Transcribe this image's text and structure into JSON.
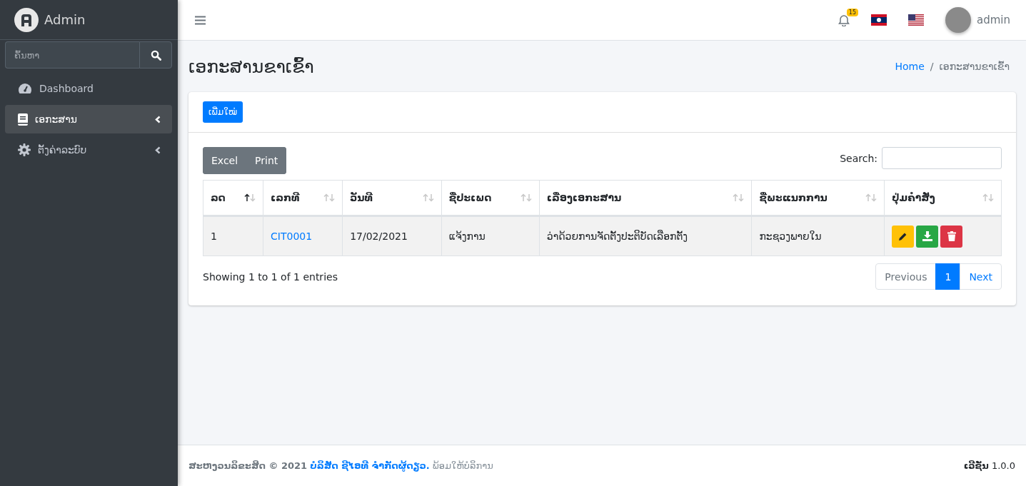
{
  "brand": {
    "name": "Admin"
  },
  "sidebar": {
    "search": {
      "placeholder": "ຄົ້ນຫາ"
    },
    "items": [
      {
        "label": "Dashboard",
        "kind": "dashboard",
        "selected": false,
        "expandable": false
      },
      {
        "label": "ເອກະສານ",
        "kind": "book",
        "selected": true,
        "expandable": true
      },
      {
        "label": "ຕັ້ງຄ່າລະບົບ",
        "kind": "gear",
        "selected": false,
        "expandable": true
      }
    ]
  },
  "topbar": {
    "notification_count": "15",
    "user": "admin"
  },
  "page": {
    "title": "ເອກະສານຂາເຂົ້າ",
    "breadcrumb_separator": "/",
    "breadcrumb": [
      {
        "label": "Home",
        "link": true
      },
      {
        "label": "ເອກະສານຂາເຂົ້າ",
        "link": false
      }
    ]
  },
  "card": {
    "add_button": "ເພີ່ມໃໝ່",
    "export_buttons": [
      "Excel",
      "Print"
    ],
    "search_label": "Search:",
    "table": {
      "columns": [
        {
          "label": "ລດ",
          "sorted": true
        },
        {
          "label": "ເລກທີ",
          "sorted": false
        },
        {
          "label": "ວັນທີ",
          "sorted": false
        },
        {
          "label": "ຊື່ປະເພດ",
          "sorted": false
        },
        {
          "label": "ເລື່ອງເອກະສານ",
          "sorted": false
        },
        {
          "label": "ຊື່ພະແນກການ",
          "sorted": false
        },
        {
          "label": "ປຸ່ມຄໍາສັ່ງ",
          "sorted": false
        }
      ],
      "rows": [
        {
          "cells": [
            "1",
            "CIT0001",
            "17/02/2021",
            "ແຈ້ງການ",
            "ວ່າດ້ວຍການຈັດຕັ້ງປະຕິບັດເລືອກຕັ້ງ",
            "ກະຊວງພາຍໃນ"
          ],
          "actions": [
            {
              "kind": "edit"
            },
            {
              "kind": "download"
            },
            {
              "kind": "delete"
            }
          ]
        }
      ]
    },
    "info": "Showing 1 to 1 of 1 entries",
    "pagination": [
      {
        "label": "Previous",
        "selected": false,
        "disabled": true
      },
      {
        "label": "1",
        "selected": true,
        "disabled": false
      },
      {
        "label": "Next",
        "selected": false,
        "disabled": false
      }
    ]
  },
  "footer": {
    "copyright": "**ສະຫງວນລິຂະສິດ © 2021**",
    "company": "ບໍລິສັດ ຊີໄອທີ ຈໍາກັດຜູ້ດຽວ.",
    "rest": "ພ້ອມໃຫ້ບໍລິການ",
    "version": "**ເວີຊັ່ນ** 1.0.0"
  }
}
